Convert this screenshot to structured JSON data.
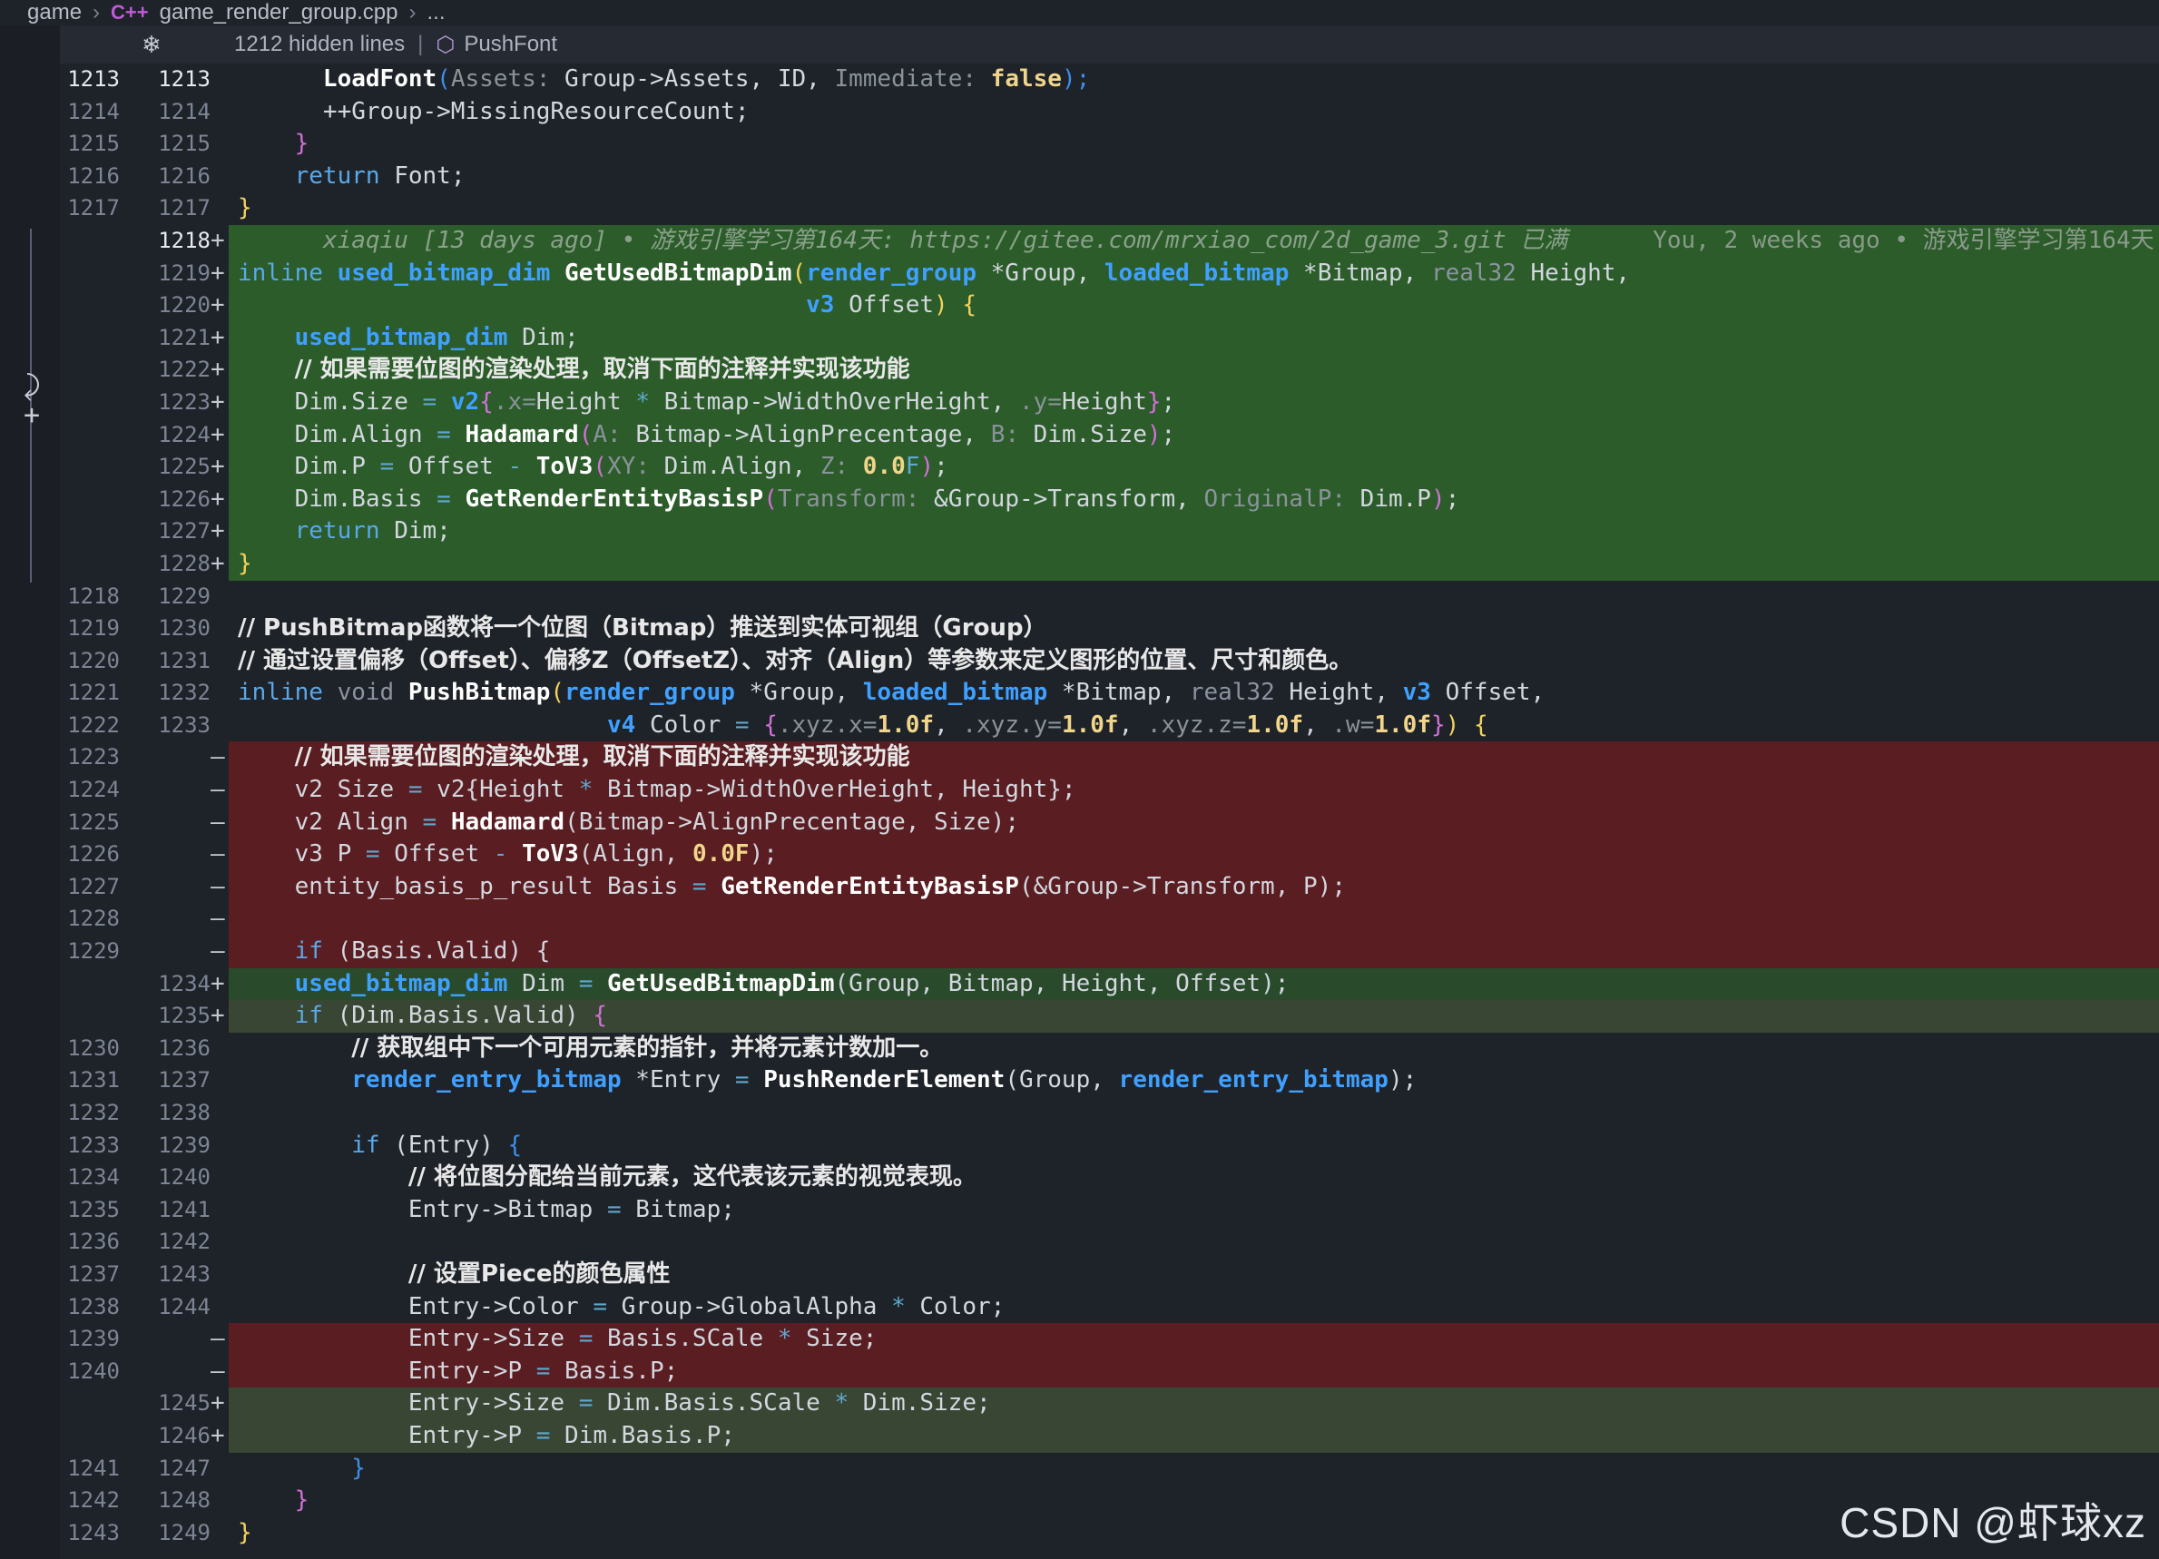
{
  "breadcrumb": {
    "folder": "game",
    "lang_icon": "C++",
    "file": "game_render_group.cpp",
    "tail": "..."
  },
  "hidden_bar": {
    "count_label": "1212 hidden lines",
    "symbol": "PushFont"
  },
  "watermark": "CSDN @虾球xz",
  "colors": {
    "added_bg": "#2b5c2a",
    "removed_bg": "#5a1d22",
    "modified_bg": "#394634",
    "keyword": "#5aa8e8",
    "type": "#3fa0ff"
  },
  "lines": [
    {
      "old": "1213",
      "new": "1213",
      "mark": ""
    },
    {
      "old": "1214",
      "new": "1214",
      "mark": ""
    },
    {
      "old": "1215",
      "new": "1215",
      "mark": ""
    },
    {
      "old": "1216",
      "new": "1216",
      "mark": ""
    },
    {
      "old": "1217",
      "new": "1217",
      "mark": ""
    },
    {
      "old": "",
      "new": "1218",
      "mark": "+"
    },
    {
      "old": "",
      "new": "1219",
      "mark": "+"
    },
    {
      "old": "",
      "new": "1220",
      "mark": "+"
    },
    {
      "old": "",
      "new": "1221",
      "mark": "+"
    },
    {
      "old": "",
      "new": "1222",
      "mark": "+"
    },
    {
      "old": "",
      "new": "1223",
      "mark": "+"
    },
    {
      "old": "",
      "new": "1224",
      "mark": "+"
    },
    {
      "old": "",
      "new": "1225",
      "mark": "+"
    },
    {
      "old": "",
      "new": "1226",
      "mark": "+"
    },
    {
      "old": "",
      "new": "1227",
      "mark": "+"
    },
    {
      "old": "",
      "new": "1228",
      "mark": "+"
    },
    {
      "old": "1218",
      "new": "1229",
      "mark": ""
    },
    {
      "old": "1219",
      "new": "1230",
      "mark": ""
    },
    {
      "old": "1220",
      "new": "1231",
      "mark": ""
    },
    {
      "old": "1221",
      "new": "1232",
      "mark": ""
    },
    {
      "old": "1222",
      "new": "1233",
      "mark": ""
    },
    {
      "old": "1223",
      "new": "",
      "mark": "—"
    },
    {
      "old": "1224",
      "new": "",
      "mark": "—"
    },
    {
      "old": "1225",
      "new": "",
      "mark": "—"
    },
    {
      "old": "1226",
      "new": "",
      "mark": "—"
    },
    {
      "old": "1227",
      "new": "",
      "mark": "—"
    },
    {
      "old": "1228",
      "new": "",
      "mark": "—"
    },
    {
      "old": "1229",
      "new": "",
      "mark": "—"
    },
    {
      "old": "",
      "new": "1234",
      "mark": "+"
    },
    {
      "old": "",
      "new": "1235",
      "mark": "+"
    },
    {
      "old": "1230",
      "new": "1236",
      "mark": ""
    },
    {
      "old": "1231",
      "new": "1237",
      "mark": ""
    },
    {
      "old": "1232",
      "new": "1238",
      "mark": ""
    },
    {
      "old": "1233",
      "new": "1239",
      "mark": ""
    },
    {
      "old": "1234",
      "new": "1240",
      "mark": ""
    },
    {
      "old": "1235",
      "new": "1241",
      "mark": ""
    },
    {
      "old": "1236",
      "new": "1242",
      "mark": ""
    },
    {
      "old": "1237",
      "new": "1243",
      "mark": ""
    },
    {
      "old": "1238",
      "new": "1244",
      "mark": ""
    },
    {
      "old": "1239",
      "new": "",
      "mark": "—"
    },
    {
      "old": "1240",
      "new": "",
      "mark": "—"
    },
    {
      "old": "",
      "new": "1245",
      "mark": "+"
    },
    {
      "old": "",
      "new": "1246",
      "mark": "+"
    },
    {
      "old": "1241",
      "new": "1247",
      "mark": ""
    },
    {
      "old": "1242",
      "new": "1248",
      "mark": ""
    },
    {
      "old": "1243",
      "new": "1249",
      "mark": ""
    }
  ],
  "code": {
    "l0": {
      "fn": "LoadFont",
      "h1": "Assets:",
      "a1": " Group->Assets, ID, ",
      "h2": "Immediate:",
      "b": " false"
    },
    "l1": "++Group->MissingResourceCount;",
    "l3": {
      "kw": "return",
      "rest": " Font;"
    },
    "blame": {
      "author": "xiaqiu [13 days ago] • 游戏引擎学习第164天: https://gitee.com/mrxiao_com/2d_game_3.git 已满",
      "inline": "You, 2 weeks ago • 游戏引擎学习第164天:"
    },
    "l6": {
      "kw": "inline",
      "ty": "used_bitmap_dim",
      "fn": "GetUsedBitmapDim",
      "t1": "render_group",
      "a1": " *Group, ",
      "t2": "loaded_bitmap",
      "a2": " *Bitmap, ",
      "t3": "real32",
      "a3": " Height,"
    },
    "l7": {
      "ty": "v3",
      "rest": " Offset"
    },
    "l8": {
      "ty": "used_bitmap_dim",
      "rest": " Dim;"
    },
    "l9": "// 如果需要位图的渲染处理，取消下面的注释并实现该功能",
    "l10": {
      "a": "Dim.Size ",
      "op": "=",
      "ty": " v2",
      "h1": ".x=",
      "b": "Height ",
      "h2": "*",
      "c": " Bitmap->WidthOverHeight, ",
      "h3": ".y=",
      "d": "Height"
    },
    "l11": {
      "a": "Dim.Align ",
      "op": "=",
      "fn": " Hadamard",
      "h1": "A:",
      "b": " Bitmap->AlignPrecentage, ",
      "h2": "B:",
      "c": " Dim.Size"
    },
    "l12": {
      "a": "Dim.P ",
      "op": "=",
      "b": " Offset ",
      "op2": "-",
      "fn": " ToV3",
      "h1": "XY:",
      "c": " Dim.Align, ",
      "h2": "Z:",
      "n": " 0.0",
      "f": "F"
    },
    "l13": {
      "a": "Dim.Basis ",
      "op": "=",
      "fn": " GetRenderEntityBasisP",
      "h1": "Transform:",
      "b": " &Group->Transform, ",
      "h2": "OriginalP:",
      "c": " Dim.P"
    },
    "l14": {
      "kw": "return",
      "rest": " Dim;"
    },
    "l17": "// PushBitmap函数将一个位图（Bitmap）推送到实体可视组（Group）",
    "l18": "// 通过设置偏移（Offset）、偏移Z（OffsetZ）、对齐（Align）等参数来定义图形的位置、尺寸和颜色。",
    "l19": {
      "kw": "inline",
      "kw2": " void",
      "fn": " PushBitmap",
      "t1": "render_group",
      "a1": " *Group, ",
      "t2": "loaded_bitmap",
      "a2": " *Bitmap, ",
      "t3": "real32",
      "a3": " Height, ",
      "t4": "v3",
      "a4": " Offset,"
    },
    "l20": {
      "ty": "v4",
      "a": " Color ",
      "op": "=",
      "h1": ".xyz.x=",
      "n1": "1.0f",
      "c1": ", ",
      "h2": ".xyz.y=",
      "n2": "1.0f",
      "c2": ", ",
      "h3": ".xyz.z=",
      "n3": "1.0f",
      "c3": ", ",
      "h4": ".w=",
      "n4": "1.0f"
    },
    "l21": "// 如果需要位图的渲染处理，取消下面的注释并实现该功能",
    "l22": {
      "a": "v2 Size ",
      "op": "=",
      "b": " v2{Height ",
      "op2": "*",
      "c": " Bitmap->WidthOverHeight, Height};"
    },
    "l23": {
      "a": "v2 Align ",
      "op": "=",
      "fn": " Hadamard",
      "b": "(Bitmap->AlignPrecentage, Size);"
    },
    "l24": {
      "a": "v3 P ",
      "op": "=",
      "b": " Offset ",
      "op2": "-",
      "fn": " ToV3",
      "c": "(Align, ",
      "n": "0.0F",
      "d": ");"
    },
    "l25": {
      "a": "entity_basis_p_result Basis ",
      "op": "=",
      "fn": " GetRenderEntityBasisP",
      "b": "(&Group->Transform, P);"
    },
    "l27": {
      "kw": "if",
      "rest": " (Basis.Valid) {"
    },
    "l28": {
      "ty": "used_bitmap_dim",
      "a": " Dim ",
      "op": "=",
      "fn": " GetUsedBitmapDim",
      "b": "(Group, Bitmap, Height, Offset);"
    },
    "l29": {
      "kw": "if",
      "rest": " (Dim.Basis.Valid) "
    },
    "l30": "// 获取组中下一个可用元素的指针，并将元素计数加一。",
    "l31": {
      "ty": "render_entry_bitmap",
      "a": " *Entry ",
      "op": "=",
      "fn": " PushRenderElement",
      "b": "(Group, ",
      "ty2": "render_entry_bitmap",
      "c": ");"
    },
    "l33": {
      "kw": "if",
      "rest": " (Entry) "
    },
    "l34": "// 将位图分配给当前元素，这代表该元素的视觉表现。",
    "l35": {
      "a": "Entry->Bitmap ",
      "op": "=",
      "b": " Bitmap;"
    },
    "l37": "// 设置Piece的颜色属性",
    "l38": {
      "a": "Entry->Color ",
      "op": "=",
      "b": " Group->GlobalAlpha ",
      "op2": "*",
      "c": " Color;"
    },
    "l39": {
      "a": "Entry->Size ",
      "op": "=",
      "b": " Basis.SCale ",
      "op2": "*",
      "c": " Size;"
    },
    "l40": {
      "a": "Entry->P ",
      "op": "=",
      "b": " Basis.P;"
    },
    "l41": {
      "a": "Entry->Size ",
      "op": "=",
      "b": " Dim.Basis.SCale ",
      "op2": "*",
      "c": " Dim.Size;"
    },
    "l42": {
      "a": "Entry->P ",
      "op": "=",
      "b": " Dim.Basis.P;"
    }
  }
}
